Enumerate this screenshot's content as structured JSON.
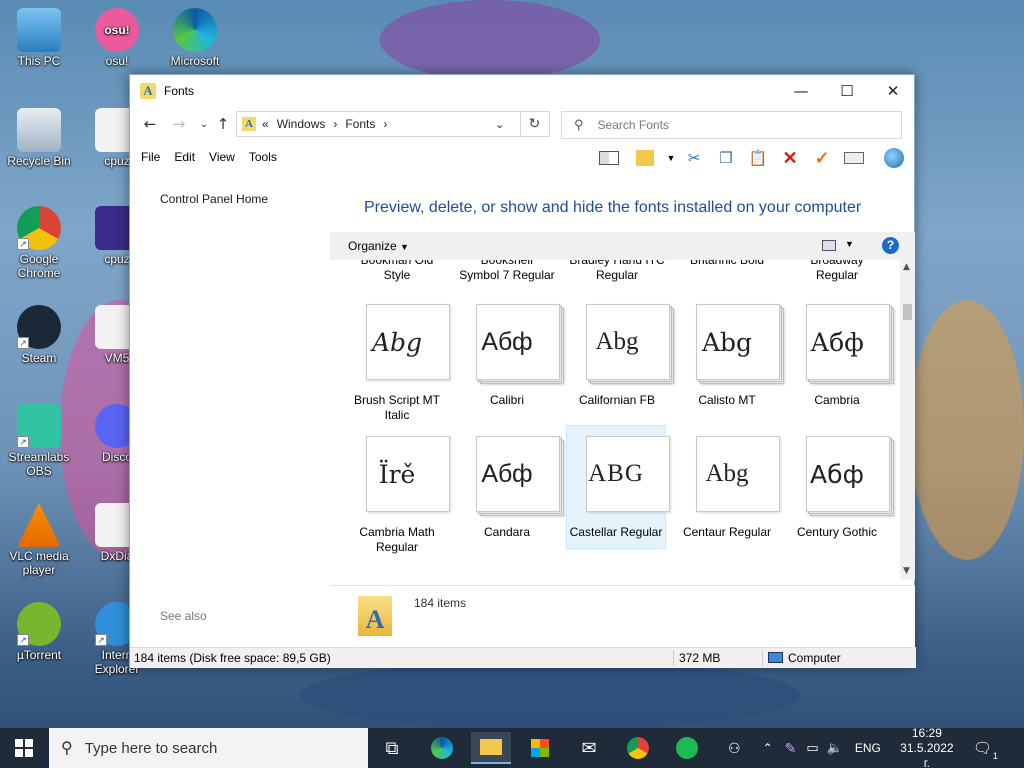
{
  "desktop": {
    "icons_col1": [
      "This PC",
      "Recycle Bin",
      "Google Chrome",
      "Steam",
      "Streamlabs OBS",
      "VLC media player",
      "µTorrent"
    ],
    "icons_col2": [
      "osu!",
      "cpuz",
      "cpuz",
      "VM5",
      "Disco",
      "DxDia",
      "Intern Explorer"
    ],
    "icons_col3": [
      "Microsoft"
    ]
  },
  "window": {
    "title": "Fonts",
    "address": {
      "root_glyph": "«",
      "crumb1": "Windows",
      "crumb2": "Fonts",
      "sep": "›"
    },
    "search_placeholder": "Search Fonts",
    "menu": [
      "File",
      "Edit",
      "View",
      "Tools"
    ],
    "left_pane": {
      "home_link": "Control Panel Home",
      "see_also": "See also"
    },
    "headline": "Preview, delete, or show and hide the fonts installed on your computer",
    "organize_label": "Organize",
    "help_glyph": "?",
    "top_row_labels": [
      [
        "Bookman Old",
        "Style"
      ],
      [
        "Bookshelf",
        "Symbol 7 Regular"
      ],
      [
        "Bradley Hand ITC",
        "Regular"
      ],
      [
        "Britannic Bold",
        ""
      ],
      [
        "Broadway",
        "Regular"
      ]
    ],
    "row2": [
      {
        "sample": "Abg",
        "label1": "Brush Script MT",
        "label2": "Italic"
      },
      {
        "sample": "Абф",
        "label1": "Calibri",
        "label2": ""
      },
      {
        "sample": "Abg",
        "label1": "Californian FB",
        "label2": ""
      },
      {
        "sample": "Abg",
        "label1": "Calisto MT",
        "label2": ""
      },
      {
        "sample": "Абф",
        "label1": "Cambria",
        "label2": ""
      }
    ],
    "row3": [
      {
        "sample": "Ïrě",
        "label1": "Cambria Math",
        "label2": "Regular"
      },
      {
        "sample": "Абф",
        "label1": "Candara",
        "label2": ""
      },
      {
        "sample": "ABG",
        "label1": "Castellar Regular",
        "label2": ""
      },
      {
        "sample": "Abg",
        "label1": "Centaur Regular",
        "label2": ""
      },
      {
        "sample": "Абф",
        "label1": "Century Gothic",
        "label2": ""
      }
    ],
    "details_count": "184 items",
    "status": {
      "left": "184 items (Disk free space: 89,5 GB)",
      "size": "372 MB",
      "location": "Computer"
    }
  },
  "taskbar": {
    "search_placeholder": "Type here to search",
    "language": "ENG",
    "time": "16:29",
    "date": "31.5.2022 г.",
    "notification_count": "1"
  }
}
